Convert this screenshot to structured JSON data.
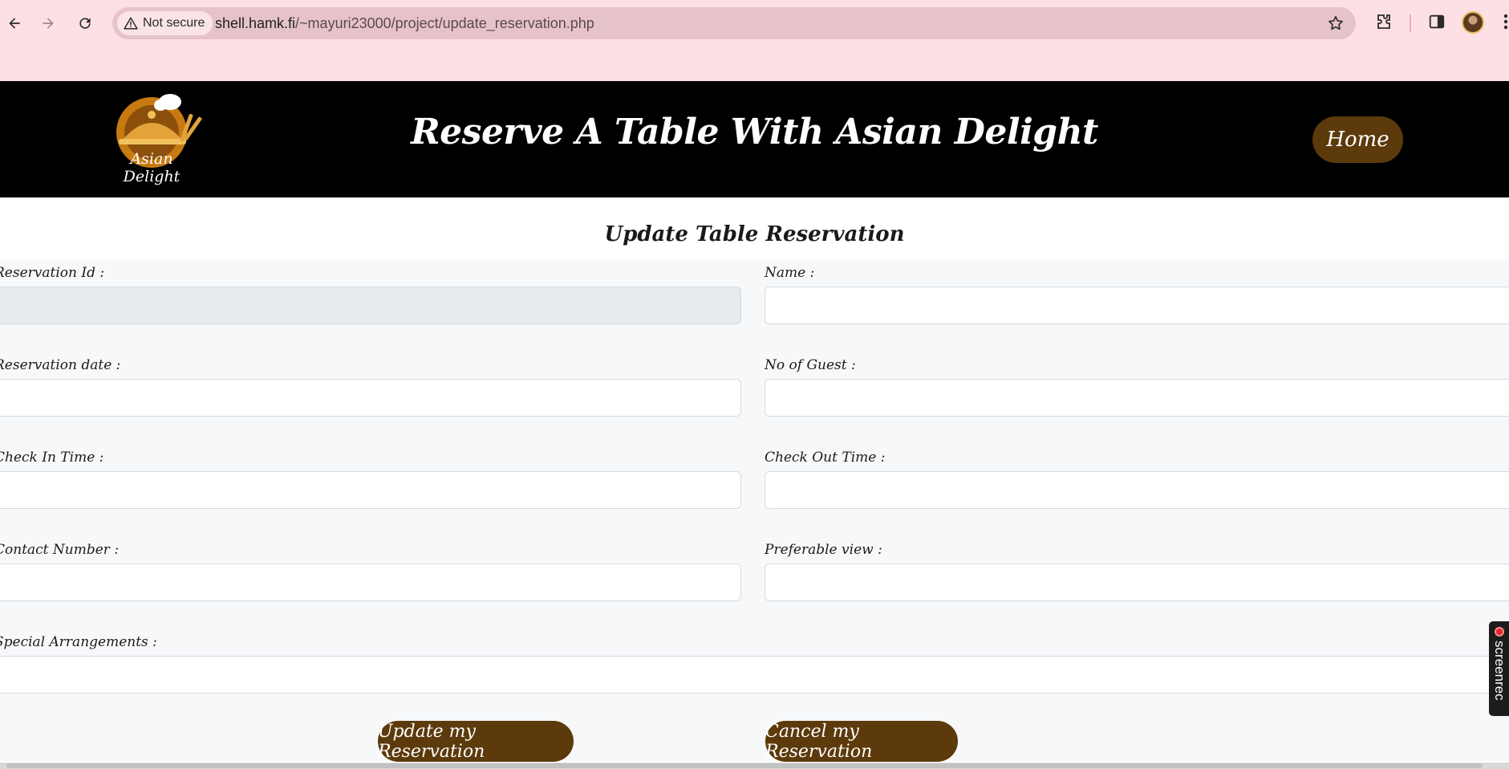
{
  "browser": {
    "security_label": "Not secure",
    "url_host": "shell.hamk.fi",
    "url_path": "/~mayuri23000/project/update_reservation.php"
  },
  "header": {
    "logo_text": "Asian Delight",
    "title": "Reserve A Table With Asian Delight",
    "home_label": "Home"
  },
  "form": {
    "heading": "Update Table Reservation",
    "fields": {
      "reservation_id": {
        "label": "Reservation Id :",
        "value": ""
      },
      "name": {
        "label": "Name :",
        "value": ""
      },
      "reservation_date": {
        "label": "Reservation date :",
        "value": ""
      },
      "guests": {
        "label": "No of Guest :",
        "value": ""
      },
      "check_in": {
        "label": "Check In Time :",
        "value": ""
      },
      "check_out": {
        "label": "Check Out Time :",
        "value": ""
      },
      "contact": {
        "label": "Contact Number :",
        "value": ""
      },
      "view": {
        "label": "Preferable view :",
        "value": ""
      },
      "special": {
        "label": "Special Arrangements :",
        "value": ""
      }
    },
    "update_label": "Update my Reservation",
    "cancel_label": "Cancel my Reservation"
  },
  "overlay": {
    "screenrec_label": "screenrec"
  },
  "colors": {
    "chrome_bg": "#fde0e5",
    "header_bg": "#000000",
    "button_brown": "#5c3a0b",
    "form_bg": "#f6f8fa"
  }
}
